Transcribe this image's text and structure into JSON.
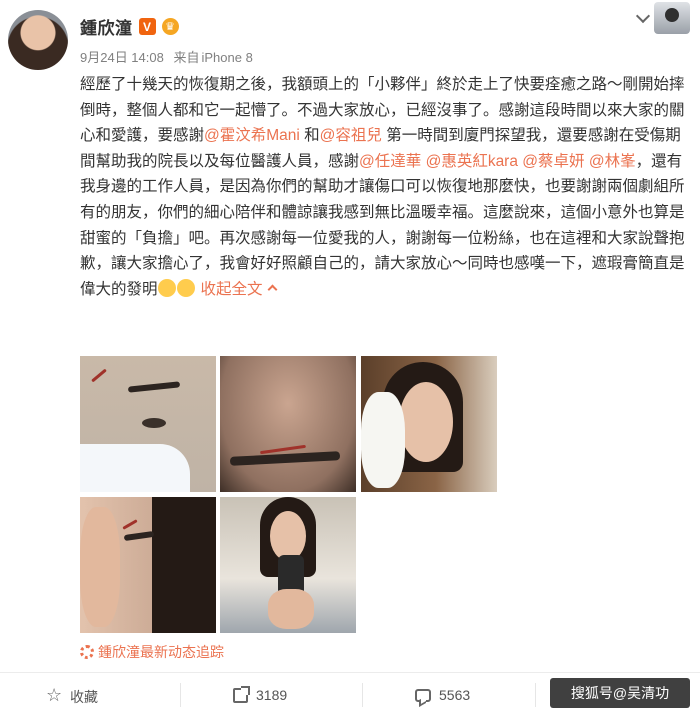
{
  "post": {
    "author": "鍾欣潼",
    "vip_badge": "V",
    "timestamp": "9月24日 14:08",
    "source_prefix": "来自",
    "source": "iPhone 8",
    "text_1": "經歷了十幾天的恢復期之後，我額頭上的「小夥伴」終於走上了快要痊癒之路～剛開始摔倒時，整個人都和它一起懵了。不過大家放心，已經沒事了。感謝這段時間以來大家的關心和愛護，要感謝",
    "mention_1": "@霍汶希Mani",
    "text_2": " 和",
    "mention_2": "@容祖兒",
    "text_3": " 第一時間到廈門探望我，還要感謝在受傷期間幫助我的院長以及每位醫護人員，感謝",
    "mention_3": "@任達華",
    "text_4": " ",
    "mention_4": "@惠英紅kara",
    "text_5": " ",
    "mention_5": "@蔡卓妍",
    "text_6": " ",
    "mention_6": "@林峯",
    "text_7": "，還有我身邊的工作人員，是因為你們的幫助才讓傷口可以恢復地那麼快，也要謝謝兩個劇組所有的朋友，你們的細心陪伴和體諒讓我感到無比溫暖幸福。這麼說來，這個小意外也算是甜蜜的「負擔」吧。再次感謝每一位愛我的人，謝謝每一位粉絲，也在這裡和大家說聲抱歉，讓大家擔心了，我會好好照顧自己的，請大家放心～同時也感嘆一下，遮瑕膏簡直是偉大的發明",
    "collapse_label": "收起全文",
    "follow_link": "鍾欣潼最新动态追踪"
  },
  "actions": {
    "favorite_label": "收藏",
    "share_count": "3189",
    "comment_count": "5563"
  },
  "watermark": "搜狐号@吴清功",
  "colors": {
    "accent": "#eb7350",
    "text": "#333333",
    "meta": "#808080"
  },
  "icons": [
    "chevron-down-icon",
    "star-icon",
    "share-icon",
    "comment-icon",
    "gear-icon",
    "emoji-icon"
  ]
}
